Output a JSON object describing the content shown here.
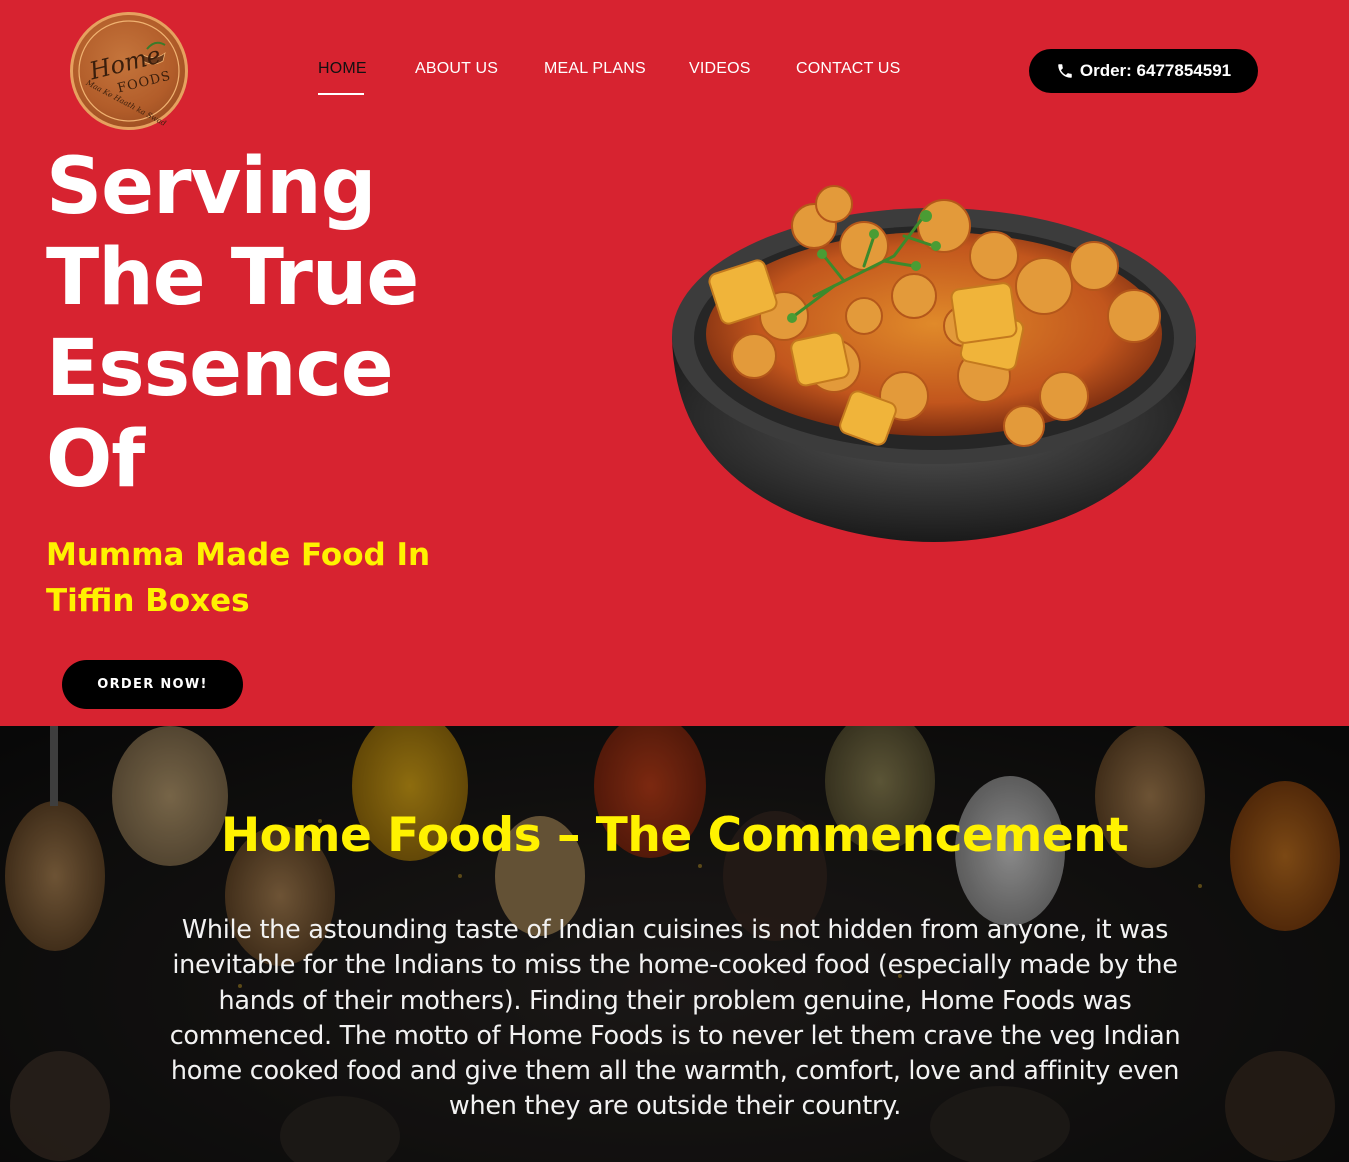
{
  "logo": {
    "brand_line1": "Home",
    "brand_line2": "FOODS",
    "tagline": "Maa Ke Haath ka Swad"
  },
  "nav": {
    "items": [
      {
        "label": "HOME",
        "active": true
      },
      {
        "label": "ABOUT US",
        "active": false
      },
      {
        "label": "MEAL PLANS",
        "active": false
      },
      {
        "label": "VIDEOS",
        "active": false
      },
      {
        "label": "CONTACT US",
        "active": false
      }
    ]
  },
  "header": {
    "order_label": "Order: 6477854591",
    "order_icon": "phone-icon"
  },
  "hero": {
    "headline_lines": [
      "Serving",
      "The True",
      "Essence",
      "Of"
    ],
    "subhead_lines": [
      "Mumma Made Food In",
      "Tiffin Boxes"
    ],
    "cta_label": "ORDER NOW!",
    "image": "curry-bowl-image"
  },
  "about": {
    "title": "Home Foods – The Commencement",
    "body_lines": [
      "While the astounding taste of Indian cuisines is not hidden from anyone, it was",
      "inevitable for the Indians to miss the home-cooked food (especially made by the",
      "hands of their mothers). Finding their problem genuine, Home Foods was",
      "commenced. The motto of Home Foods is to never let them crave the veg Indian",
      "home cooked food and give them all the warmth, comfort, love and affinity even",
      "when they are outside their country."
    ],
    "background": "spices-background-image"
  },
  "colors": {
    "hero_bg": "#d72330",
    "accent_yellow": "#fff200",
    "button_black": "#000000",
    "text_white": "#ffffff"
  }
}
